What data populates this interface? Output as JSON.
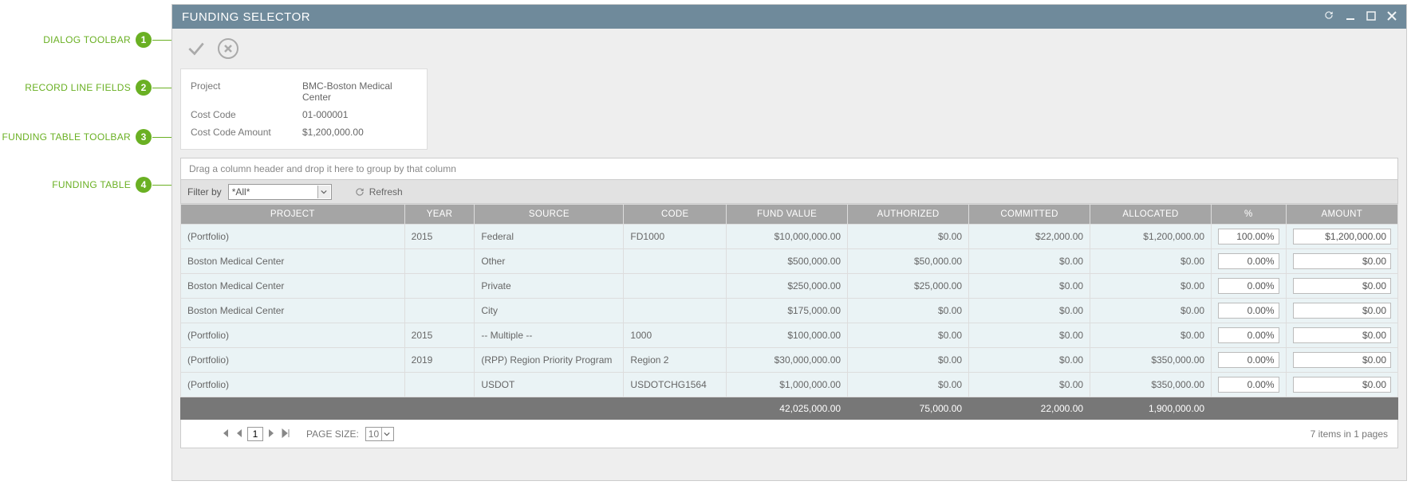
{
  "callouts": [
    {
      "label": "DIALOG TOOLBAR",
      "num": "1"
    },
    {
      "label": "RECORD LINE FIELDS",
      "num": "2"
    },
    {
      "label": "FUNDING TABLE TOOLBAR",
      "num": "3"
    },
    {
      "label": "FUNDING TABLE",
      "num": "4"
    }
  ],
  "dialog": {
    "title": "FUNDING SELECTOR"
  },
  "record": {
    "project_label": "Project",
    "project_value": "BMC-Boston Medical Center",
    "costcode_label": "Cost Code",
    "costcode_value": "01-000001",
    "amount_label": "Cost Code Amount",
    "amount_value": "$1,200,000.00"
  },
  "grid": {
    "group_drop": "Drag a column header and drop it here to group by that column",
    "filter_label": "Filter by",
    "filter_value": "*All*",
    "refresh_label": "Refresh",
    "columns": {
      "project": "PROJECT",
      "year": "YEAR",
      "source": "SOURCE",
      "code": "CODE",
      "fund_value": "FUND VALUE",
      "authorized": "AUTHORIZED",
      "committed": "COMMITTED",
      "allocated": "ALLOCATED",
      "pct": "%",
      "amount": "AMOUNT"
    },
    "rows": [
      {
        "project": "(Portfolio)",
        "year": "2015",
        "source": "Federal",
        "code": "FD1000",
        "fund_value": "$10,000,000.00",
        "authorized": "$0.00",
        "committed": "$22,000.00",
        "allocated": "$1,200,000.00",
        "pct": "100.00%",
        "amount": "$1,200,000.00"
      },
      {
        "project": "Boston Medical Center",
        "year": "",
        "source": "Other",
        "code": "",
        "fund_value": "$500,000.00",
        "authorized": "$50,000.00",
        "committed": "$0.00",
        "allocated": "$0.00",
        "pct": "0.00%",
        "amount": "$0.00"
      },
      {
        "project": "Boston Medical Center",
        "year": "",
        "source": "Private",
        "code": "",
        "fund_value": "$250,000.00",
        "authorized": "$25,000.00",
        "committed": "$0.00",
        "allocated": "$0.00",
        "pct": "0.00%",
        "amount": "$0.00"
      },
      {
        "project": "Boston Medical Center",
        "year": "",
        "source": "City",
        "code": "",
        "fund_value": "$175,000.00",
        "authorized": "$0.00",
        "committed": "$0.00",
        "allocated": "$0.00",
        "pct": "0.00%",
        "amount": "$0.00"
      },
      {
        "project": "(Portfolio)",
        "year": "2015",
        "source": "-- Multiple --",
        "code": "1000",
        "fund_value": "$100,000.00",
        "authorized": "$0.00",
        "committed": "$0.00",
        "allocated": "$0.00",
        "pct": "0.00%",
        "amount": "$0.00"
      },
      {
        "project": "(Portfolio)",
        "year": "2019",
        "source": "(RPP) Region Priority Program",
        "code": "Region 2",
        "fund_value": "$30,000,000.00",
        "authorized": "$0.00",
        "committed": "$0.00",
        "allocated": "$350,000.00",
        "pct": "0.00%",
        "amount": "$0.00"
      },
      {
        "project": "(Portfolio)",
        "year": "",
        "source": "USDOT",
        "code": "USDOTCHG1564",
        "fund_value": "$1,000,000.00",
        "authorized": "$0.00",
        "committed": "$0.00",
        "allocated": "$350,000.00",
        "pct": "0.00%",
        "amount": "$0.00"
      }
    ],
    "totals": {
      "fund_value": "42,025,000.00",
      "authorized": "75,000.00",
      "committed": "22,000.00",
      "allocated": "1,900,000.00"
    }
  },
  "pager": {
    "page": "1",
    "page_size_label": "PAGE SIZE:",
    "page_size": "10",
    "summary": "7 items in 1 pages"
  }
}
